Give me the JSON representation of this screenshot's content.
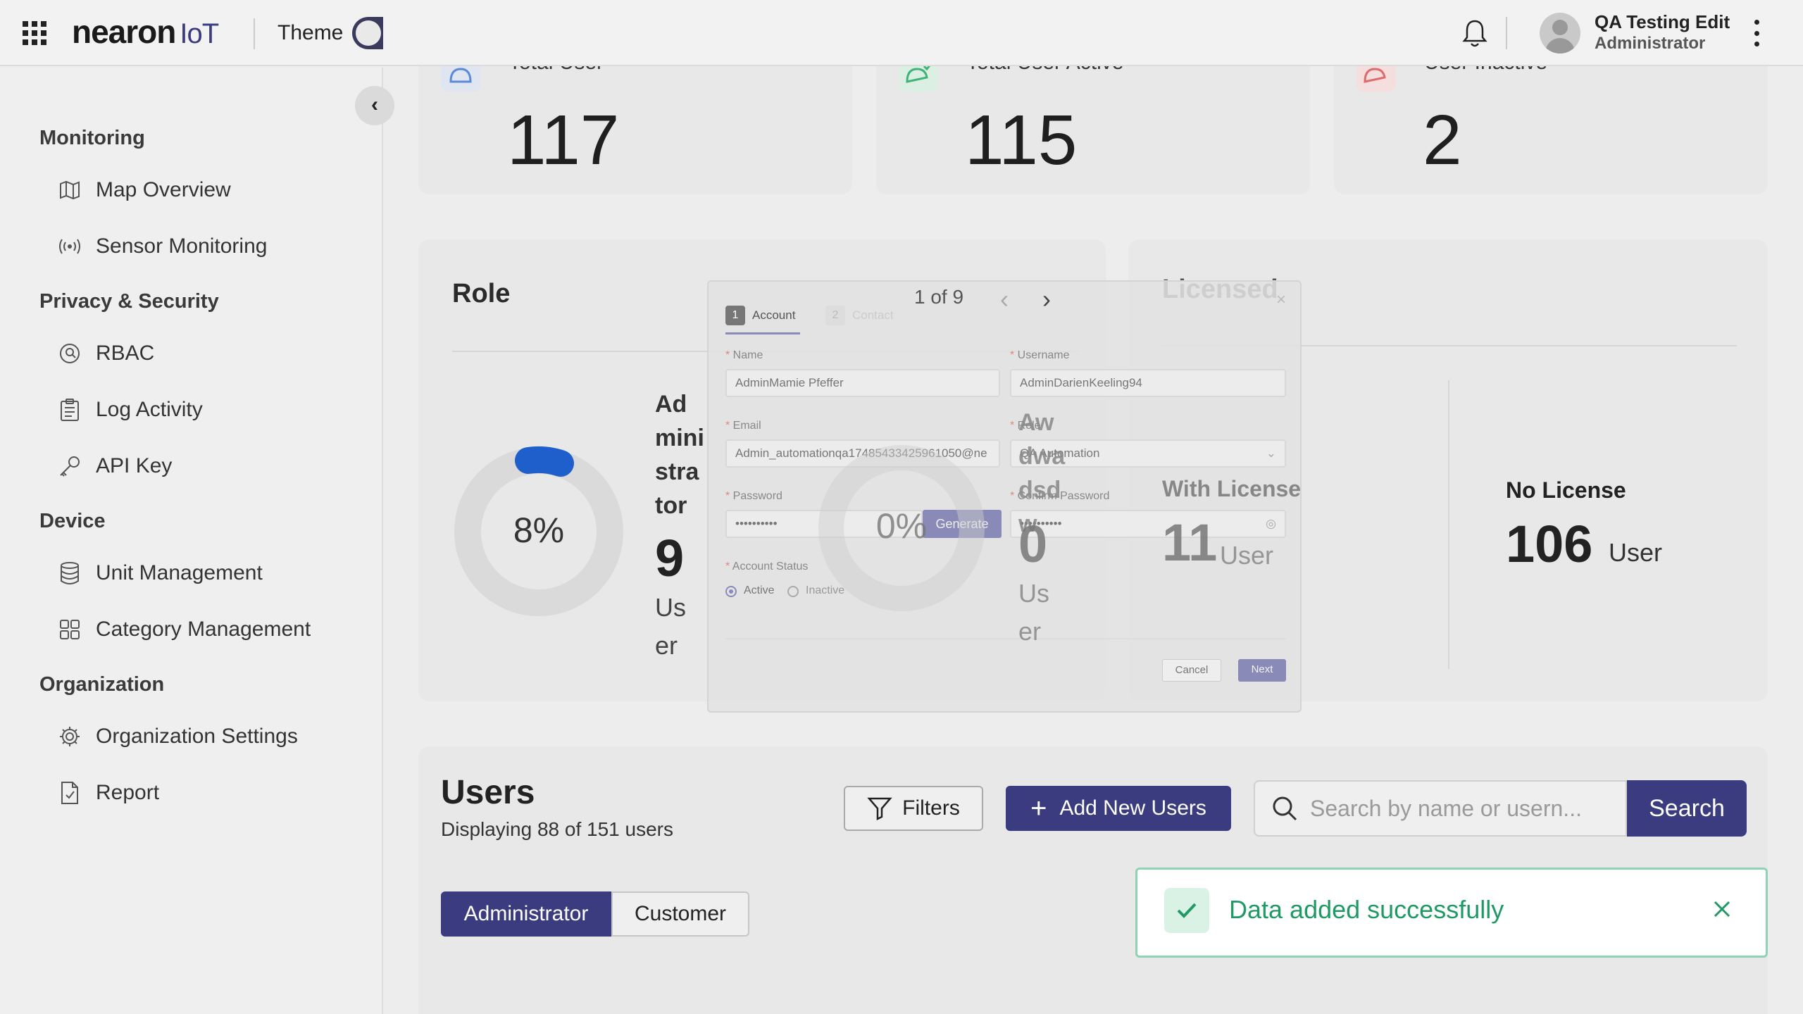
{
  "header": {
    "logo_main": "nearon",
    "logo_sub": "IoT",
    "theme_label": "Theme",
    "user_name": "QA Testing Edit",
    "user_role": "Administrator"
  },
  "sidebar": {
    "sections": [
      {
        "title": "Monitoring",
        "items": [
          "Map Overview",
          "Sensor Monitoring"
        ]
      },
      {
        "title": "Privacy & Security",
        "items": [
          "RBAC",
          "Log Activity",
          "API Key"
        ]
      },
      {
        "title": "Device",
        "items": [
          "Unit Management",
          "Category Management"
        ]
      },
      {
        "title": "Organization",
        "items": [
          "Organization Settings",
          "Report"
        ]
      }
    ]
  },
  "stats": [
    {
      "label": "Total User",
      "value": "117",
      "color": "#5b8ad8"
    },
    {
      "label": "Total User Active",
      "value": "115",
      "color": "#3fb37a"
    },
    {
      "label": "User Inactive",
      "value": "2",
      "color": "#e06a6a"
    }
  ],
  "role_panel": {
    "title": "Role",
    "admin": {
      "percent": "8%",
      "label": "Administrator",
      "count": "9",
      "unit": "User"
    },
    "other": {
      "percent": "0%",
      "label": "Awdwadsdw",
      "count": "0",
      "unit": "User"
    }
  },
  "license_panel": {
    "title": "Licensed",
    "with_label": "With License",
    "with_count": "11",
    "with_unit": "User",
    "no_label": "No License",
    "no_count": "106",
    "no_unit": "User"
  },
  "users": {
    "title": "Users",
    "subtitle": "Displaying 88 of 151 users",
    "filters_label": "Filters",
    "add_label": "Add New Users",
    "search_placeholder": "Search by name or usern...",
    "search_button": "Search",
    "tabs": [
      "Administrator",
      "Customer"
    ]
  },
  "modal": {
    "pager": "1 of 9",
    "steps": [
      {
        "num": "1",
        "label": "Account"
      },
      {
        "num": "2",
        "label": "Contact"
      }
    ],
    "fields": {
      "name_label": "Name",
      "name_value": "AdminMamie Pfeffer",
      "username_label": "Username",
      "username_value": "AdminDarienKeeling94",
      "email_label": "Email",
      "email_value": "Admin_automationqa17485433425961050@ne",
      "role_label": "Role",
      "role_value": "QA Automation",
      "password_label": "Password",
      "password_value": "••••••••••",
      "generate_label": "Generate",
      "confirm_label": "Confirm Password",
      "confirm_value": "••••••••••",
      "status_label": "Account Status",
      "status_active": "Active",
      "status_inactive": "Inactive"
    },
    "cancel_label": "Cancel",
    "next_label": "Next"
  },
  "toast": {
    "message": "Data added successfully"
  }
}
